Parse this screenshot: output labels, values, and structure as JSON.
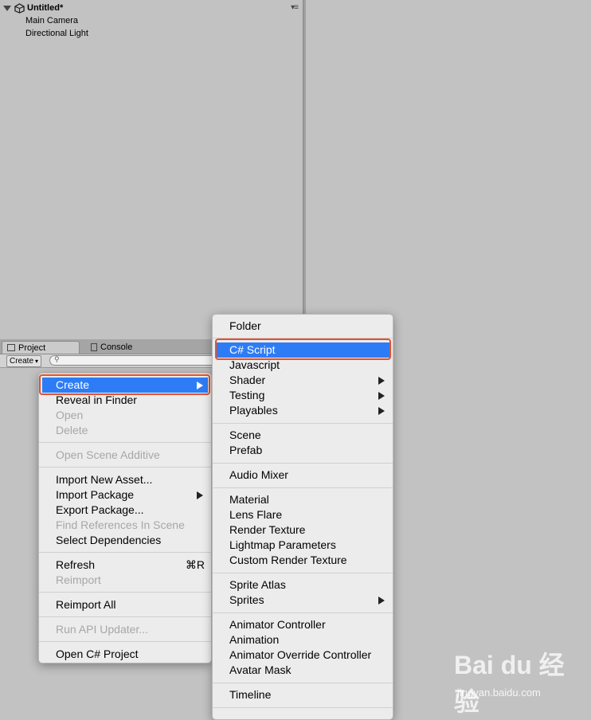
{
  "hierarchy": {
    "scene_title": "Untitled*",
    "menu_glyph": "▾≡",
    "items": [
      "Main Camera",
      "Directional Light"
    ]
  },
  "project": {
    "tabs": [
      "Project",
      "Console"
    ],
    "create_label": "Create",
    "create_caret": "▾"
  },
  "context_menu": {
    "items": [
      {
        "label": "Create",
        "state": "selected"
      },
      {
        "label": "Reveal in Finder"
      },
      {
        "label": "Open",
        "state": "disabled"
      },
      {
        "label": "Delete",
        "state": "disabled"
      },
      {
        "label": "Open Scene Additive",
        "state": "disabled"
      },
      {
        "label": "Import New Asset..."
      },
      {
        "label": "Import Package"
      },
      {
        "label": "Export Package..."
      },
      {
        "label": "Find References In Scene",
        "state": "disabled"
      },
      {
        "label": "Select Dependencies"
      },
      {
        "label": "Refresh",
        "shortcut": "⌘R"
      },
      {
        "label": "Reimport",
        "state": "disabled"
      },
      {
        "label": "Reimport All"
      },
      {
        "label": "Run API Updater...",
        "state": "disabled"
      },
      {
        "label": "Open C# Project"
      }
    ]
  },
  "create_submenu": {
    "items": [
      {
        "label": "Folder"
      },
      {
        "label": "C# Script",
        "state": "selected"
      },
      {
        "label": "Javascript"
      },
      {
        "label": "Shader"
      },
      {
        "label": "Testing"
      },
      {
        "label": "Playables"
      },
      {
        "label": "Scene"
      },
      {
        "label": "Prefab"
      },
      {
        "label": "Audio Mixer"
      },
      {
        "label": "Material"
      },
      {
        "label": "Lens Flare"
      },
      {
        "label": "Render Texture"
      },
      {
        "label": "Lightmap Parameters"
      },
      {
        "label": "Custom Render Texture"
      },
      {
        "label": "Sprite Atlas"
      },
      {
        "label": "Sprites"
      },
      {
        "label": "Animator Controller"
      },
      {
        "label": "Animation"
      },
      {
        "label": "Animator Override Controller"
      },
      {
        "label": "Avatar Mask"
      },
      {
        "label": "Timeline"
      }
    ]
  },
  "watermark": {
    "brand": "Bai du 经验",
    "url": "jingyan.baidu.com"
  },
  "colors": {
    "selection": "#2d7cf6",
    "annotation": "#e4512d",
    "background": "#c2c2c2"
  }
}
